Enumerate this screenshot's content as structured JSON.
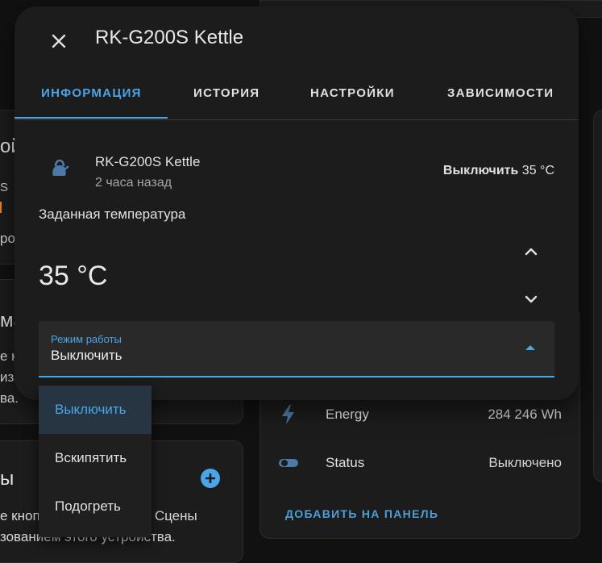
{
  "background": {
    "left_fragments": {
      "line1": "ой",
      "line2": "S",
      "line3": "ро",
      "heading2": "ма",
      "text_a": "е кн",
      "text_b": "иза",
      "text_c": "ва.",
      "heading3": "ы",
      "text_d": "е кнопку, чтобы создать Сцены",
      "text_e": "зованием этого устройства."
    },
    "rows": [
      {
        "icon": "lightning-icon",
        "label": "Energy",
        "value": "284 246 Wh"
      },
      {
        "icon": "toggle-icon",
        "label": "Status",
        "value": "Выключено"
      }
    ],
    "add_to_panel": "ДОБАВИТЬ НА ПАНЕЛЬ"
  },
  "dialog": {
    "title": "RK-G200S Kettle",
    "tabs": [
      "ИНФОРМАЦИЯ",
      "ИСТОРИЯ",
      "НАСТРОЙКИ",
      "ЗАВИСИМОСТИ"
    ],
    "active_tab": 0,
    "entity": {
      "icon": "kettle-icon",
      "name": "RK-G200S Kettle",
      "last_changed": "2 часа назад",
      "state_mode": "Выключить",
      "state_temp": "35 °C"
    },
    "target_temperature": {
      "label": "Заданная температура",
      "value": "35 °C"
    },
    "mode_select": {
      "label": "Режим работы",
      "value": "Выключить",
      "options": [
        "Выключить",
        "Вскипятить",
        "Подогреть"
      ],
      "selected_index": 0
    }
  },
  "colors": {
    "accent": "#49a6e8",
    "surface": "#1c1c1c",
    "background": "#111111",
    "icon": "#4b7aa8"
  }
}
